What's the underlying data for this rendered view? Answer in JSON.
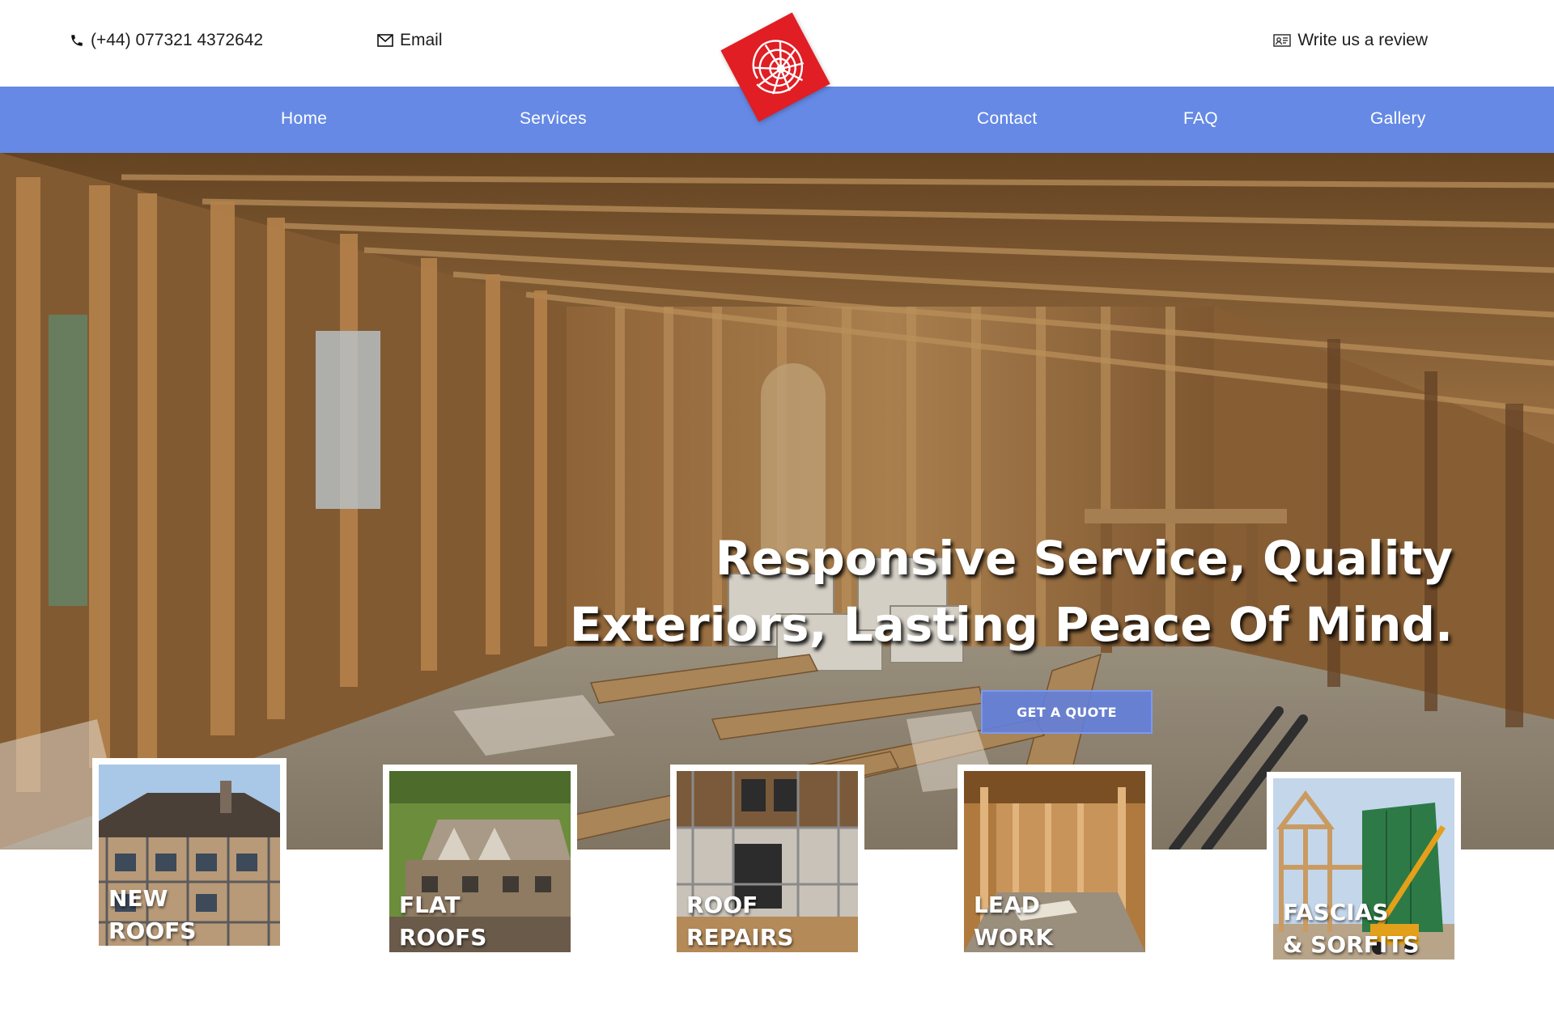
{
  "header": {
    "phone": "(+44) 077321 4372642",
    "email_label": "Email",
    "review_label": "Write us a review"
  },
  "nav": {
    "items": [
      "Home",
      "Services",
      "Contact",
      "FAQ",
      "Gallery"
    ]
  },
  "hero": {
    "title_line1": "Responsive Service, Quality",
    "title_line2": "Exteriors, Lasting Peace Of Mind.",
    "cta_label": "GET A QUOTE"
  },
  "services": [
    {
      "line1": "NEW",
      "line2": "ROOFS"
    },
    {
      "line1": "FLAT",
      "line2": "ROOFS"
    },
    {
      "line1": "ROOF",
      "line2": "REPAIRS"
    },
    {
      "line1": "LEAD",
      "line2": "WORK"
    },
    {
      "line1": "FASCIAS",
      "line2": "& SORFITS"
    }
  ],
  "colors": {
    "nav_bg": "#6589e5",
    "logo_red": "#e01e24",
    "cta_bg": "#6280de"
  },
  "icons": [
    "phone-icon",
    "mail-icon",
    "review-card-icon",
    "shell-logo-icon"
  ]
}
